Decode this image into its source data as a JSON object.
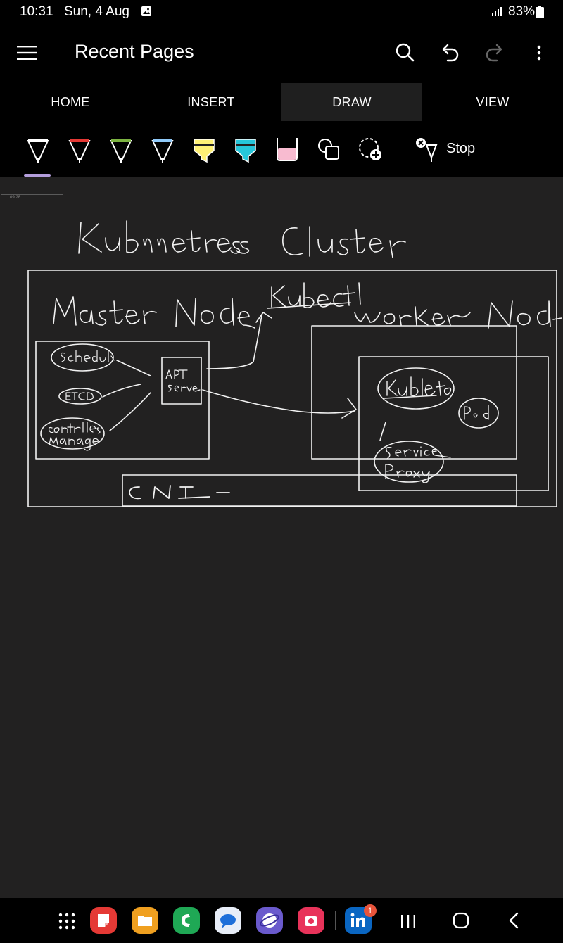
{
  "status_bar": {
    "time": "10:31",
    "date": "Sun, 4 Aug",
    "battery": "83%"
  },
  "app_bar": {
    "title": "Recent Pages",
    "icons": [
      "hamburger-icon",
      "search-icon",
      "undo-icon",
      "redo-icon",
      "more-vert-icon"
    ]
  },
  "tabs": [
    {
      "label": "HOME",
      "active": false
    },
    {
      "label": "INSERT",
      "active": false
    },
    {
      "label": "DRAW",
      "active": true
    },
    {
      "label": "VIEW",
      "active": false
    }
  ],
  "draw_toolbar": {
    "tools": [
      {
        "name": "pen-white",
        "color": "#ffffff",
        "selected": true
      },
      {
        "name": "pen-red",
        "color": "#e53935"
      },
      {
        "name": "pen-green",
        "color": "#7cb342"
      },
      {
        "name": "pen-blue",
        "color": "#90caf9"
      },
      {
        "name": "highlighter-yellow",
        "color": "#fff176"
      },
      {
        "name": "highlighter-cyan",
        "color": "#26c6da"
      },
      {
        "name": "highlighter-pink",
        "color": "#f8bbd0"
      },
      {
        "name": "shapes-icon"
      },
      {
        "name": "lasso-add-icon"
      }
    ],
    "stop_label": "Stop"
  },
  "canvas": {
    "page_date": "09:28",
    "handwriting": {
      "title": "Kubernetes Cluster",
      "master_node": "Master Node",
      "kubectl": "Kubectl",
      "worker_node": "Worker Node",
      "scheduler": "Scheduler",
      "etcd": "ETCD",
      "controller_manager": "Controller Manager",
      "api_server": "API Server",
      "kubelet": "Kubelet",
      "pod": "Pod",
      "service_proxy": "Service Proxy",
      "cni": "CNI"
    }
  },
  "nav_bar": {
    "apps": [
      {
        "name": "apps-grid-icon"
      },
      {
        "name": "app-red-notes",
        "color": "#e53935"
      },
      {
        "name": "app-files",
        "color": "#f0a020"
      },
      {
        "name": "app-phone",
        "color": "#1fa855"
      },
      {
        "name": "app-messages",
        "color": "#e8eef8"
      },
      {
        "name": "app-internet",
        "color": "#6a5acd"
      },
      {
        "name": "app-camera",
        "color": "#e8335a"
      },
      {
        "name": "app-linkedin",
        "color": "#0a66c2",
        "badge": "1"
      }
    ]
  }
}
